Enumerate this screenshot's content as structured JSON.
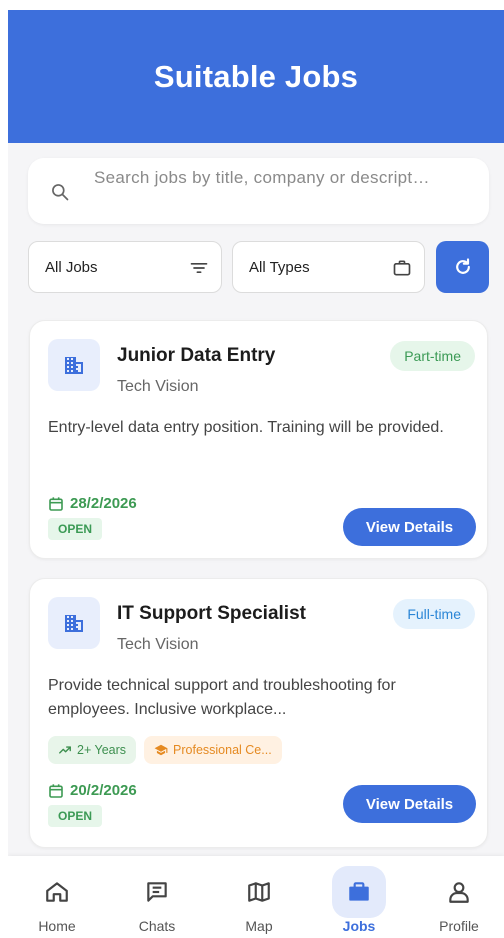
{
  "header": {
    "title": "Suitable Jobs"
  },
  "search": {
    "placeholder": "Search jobs by title, company or descript…"
  },
  "filters": {
    "jobs": {
      "value": "All Jobs"
    },
    "types": {
      "value": "All Types"
    }
  },
  "jobs": [
    {
      "title": "Junior Data Entry",
      "company": "Tech Vision",
      "type": "Part-time",
      "description": "Entry-level data entry position. Training will be provided.",
      "date": "28/2/2026",
      "status": "OPEN",
      "action": "View Details"
    },
    {
      "title": "IT Support Specialist",
      "company": "Tech Vision",
      "type": "Full-time",
      "description": "Provide technical support and troubleshooting for employees. Inclusive workplace...",
      "tags": [
        "2+ Years",
        "Professional Ce..."
      ],
      "date": "20/2/2026",
      "status": "OPEN",
      "action": "View Details"
    }
  ],
  "nav": {
    "items": [
      {
        "label": "Home",
        "icon": "home-icon"
      },
      {
        "label": "Chats",
        "icon": "chat-icon"
      },
      {
        "label": "Map",
        "icon": "map-icon"
      },
      {
        "label": "Jobs",
        "icon": "briefcase-icon"
      },
      {
        "label": "Profile",
        "icon": "person-icon"
      }
    ],
    "active": "Jobs"
  },
  "colors": {
    "primary": "#3d6fdc",
    "green": "#3d9a53",
    "blue_badge": "#2b86d6",
    "orange": "#e58a22"
  }
}
